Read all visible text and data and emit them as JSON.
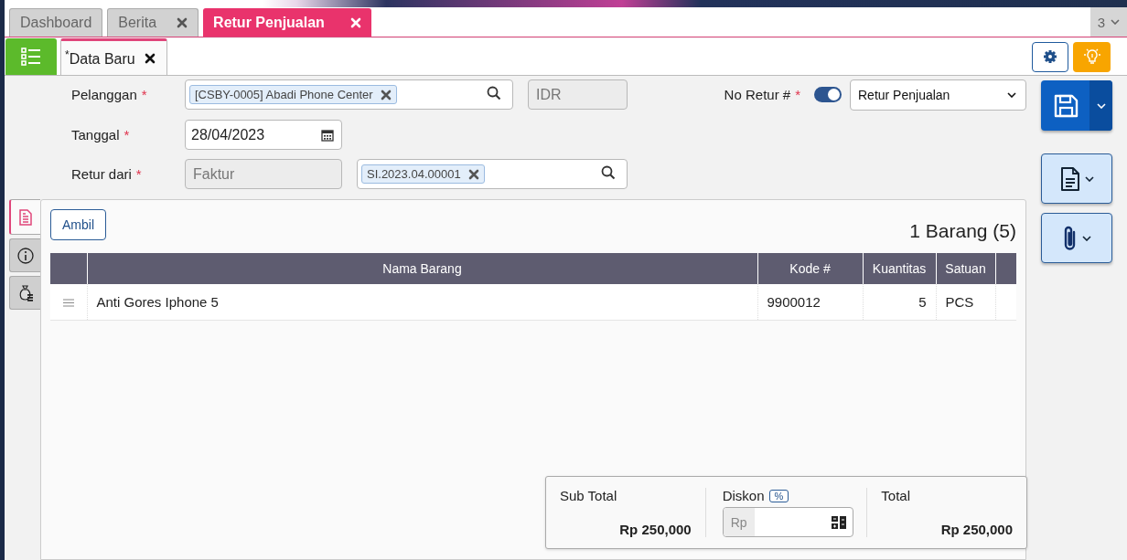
{
  "app_tabs": [
    {
      "label": "Dashboard",
      "closable": false,
      "selected": false
    },
    {
      "label": "Berita",
      "closable": true,
      "selected": false
    },
    {
      "label": "Retur Penjualan",
      "closable": true,
      "selected": true
    }
  ],
  "tab_overflow": {
    "count": "3"
  },
  "doc_tabs": [
    {
      "label": "$^{*}$Data Baru",
      "selected": true
    }
  ],
  "form": {
    "customer": {
      "label": "Pelanggan",
      "required_mark": "*",
      "chip": "[CSBY-0005] Abadi Phone Center"
    },
    "currency": "IDR",
    "date": {
      "label": "Tanggal",
      "required_mark": "*",
      "value": "28/04/2023"
    },
    "return_from": {
      "label": "Retur dari",
      "required_mark": "*",
      "source": "Faktur",
      "chip": "SI.2023.04.00001"
    },
    "return_no": {
      "label": "No Retur #",
      "required_mark": "*",
      "auto_number": true,
      "series": "Retur Penjualan"
    }
  },
  "actions": [
    {
      "kind": "save"
    },
    {
      "kind": "document"
    },
    {
      "kind": "attachment"
    }
  ],
  "side_tabs": [
    {
      "kind": "document",
      "selected": true
    },
    {
      "kind": "info",
      "selected": false
    },
    {
      "kind": "money",
      "selected": false
    }
  ],
  "items": {
    "take_button": "Ambil",
    "summary": "1 Barang (5)",
    "columns": [
      "Nama Barang",
      "Kode #",
      "Kuantitas",
      "Satuan"
    ],
    "rows": [
      {
        "name": "Anti Gores Iphone 5",
        "code": "9900012",
        "quantity": "5",
        "unit": "PCS"
      }
    ]
  },
  "totals": {
    "sub_total_label": "Sub Total",
    "sub_total": "Rp 250,000",
    "discount_label": "Diskon",
    "discount_mode": "%",
    "discount_prefix": "Rp",
    "total_label": "Total",
    "total": "Rp 250,000"
  }
}
